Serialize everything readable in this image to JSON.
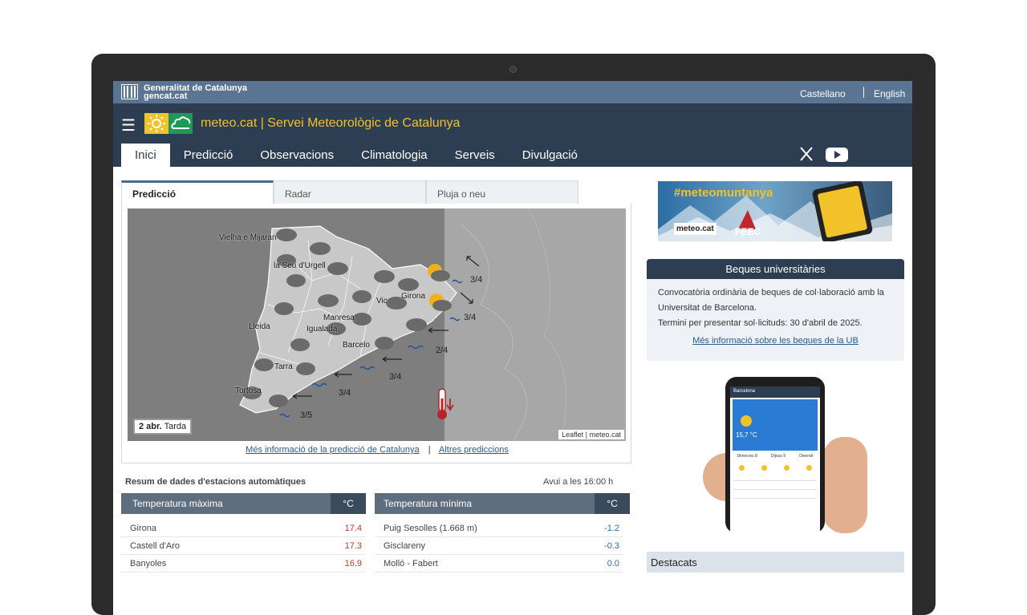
{
  "gencat": {
    "name_line1": "Generalitat de Catalunya",
    "name_line2": "gencat.cat",
    "lang_es": "Castellano",
    "lang_en": "English"
  },
  "header": {
    "title": "meteo.cat | Servei Meteorològic de Catalunya",
    "menu_icon": "☰",
    "nav": [
      "Inici",
      "Predicció",
      "Observacions",
      "Climatologia",
      "Serveis",
      "Divulgació"
    ],
    "social_icons": [
      "facebook-icon",
      "x-icon",
      "youtube-icon",
      "instagram-icon",
      "linkedin-icon",
      "rss-icon"
    ],
    "social_glyphs": [
      "",
      "𝕏",
      "▶",
      "",
      "",
      ""
    ]
  },
  "tabs": [
    "Predicció",
    "Radar",
    "Pluja o neu"
  ],
  "map": {
    "date_bold": "2 abr.",
    "date_rest": "Tarda",
    "attribution": "Leaflet | meteo.cat",
    "places": [
      "Vielha e Mijaran",
      "la Seu d'Urgell",
      "Vic",
      "Girona",
      "Manresa",
      "Lleida",
      "Igualada",
      "Barcelo",
      "Tarra",
      "Tortosa"
    ],
    "waves": [
      "3/4",
      "3/4",
      "2/4",
      "3/4",
      "3/4",
      "3/5"
    ]
  },
  "map_links": {
    "link1": "Més informació de la predicció de Catalunya",
    "separator": "|",
    "link2": "Altres prediccions"
  },
  "resum": {
    "title": "Resum de dades d'estacions automàtiques",
    "time": "Avui a les 16:00 h",
    "max_header": "Temperatura màxima",
    "min_header": "Temperatura mínima",
    "unit": "°C",
    "max_rows": [
      {
        "name": "Girona",
        "value": "17.4"
      },
      {
        "name": "Castell d'Aro",
        "value": "17.3"
      },
      {
        "name": "Banyoles",
        "value": "16.9"
      }
    ],
    "min_rows": [
      {
        "name": "Puig Sesolles (1.668 m)",
        "value": "-1.2"
      },
      {
        "name": "Gisclareny",
        "value": "-0.3"
      },
      {
        "name": "Molló - Fabert",
        "value": "0.0"
      }
    ]
  },
  "banner": {
    "hashtag": "#meteomuntanya",
    "brand1": "meteo.cat",
    "brand2": "FEEC"
  },
  "beques": {
    "title": "Beques universitàries",
    "text1": "Convocatòria ordinària de beques de col·laboració amb la Universitat de Barcelona.",
    "text2": "Termini per presentar sol·licituds: 30 d'abril de 2025.",
    "link": "Més informació sobre les beques de la UB"
  },
  "phone": {
    "city": "Barcelona",
    "temp": "15,7 °C",
    "days": [
      "Dimecres 8",
      "Dijous 9",
      "Divendr"
    ]
  },
  "destacats": {
    "title": "Destacats"
  }
}
